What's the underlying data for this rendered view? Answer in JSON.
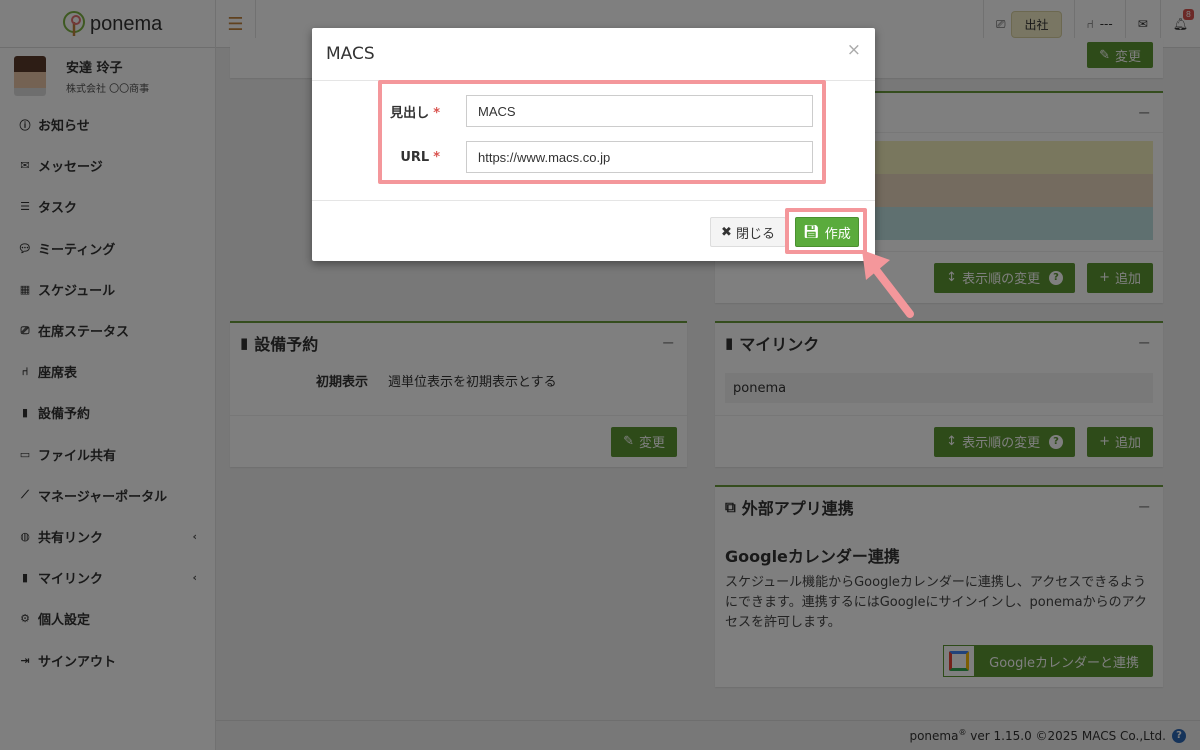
{
  "app": {
    "brand": "ponema"
  },
  "topbar": {
    "attendance_status": "出社",
    "seat_status": "---",
    "notification_count": "8"
  },
  "user": {
    "name": "安達 玲子",
    "company": "株式会社 〇〇商事"
  },
  "sidebar": {
    "items": [
      {
        "label": "お知らせ",
        "icon": "info-icon"
      },
      {
        "label": "メッセージ",
        "icon": "envelope-icon"
      },
      {
        "label": "タスク",
        "icon": "list-check-icon"
      },
      {
        "label": "ミーティング",
        "icon": "chat-icon"
      },
      {
        "label": "スケジュール",
        "icon": "calendar-icon"
      },
      {
        "label": "在席ステータス",
        "icon": "presence-icon"
      },
      {
        "label": "座席表",
        "icon": "chair-icon"
      },
      {
        "label": "設備予約",
        "icon": "door-icon"
      },
      {
        "label": "ファイル共有",
        "icon": "folder-icon"
      },
      {
        "label": "マネージャーポータル",
        "icon": "chart-icon"
      },
      {
        "label": "共有リンク",
        "icon": "globe-icon"
      },
      {
        "label": "マイリンク",
        "icon": "bookmark-icon"
      },
      {
        "label": "個人設定",
        "icon": "gear-icon"
      },
      {
        "label": "サインアウト",
        "icon": "signout-icon"
      }
    ]
  },
  "panels": {
    "top_left_btn": "変更",
    "facility": {
      "title": "設備予約",
      "setting_label": "初期表示",
      "setting_value": "週単位表示を初期表示とする",
      "change_label": "変更"
    },
    "colors": {
      "order_label": "表示順の変更",
      "add_label": "追加",
      "row_colors": [
        "#f3efbd",
        "#e9d6bf",
        "#bfe1e1"
      ]
    },
    "mylink": {
      "title": "マイリンク",
      "items": [
        "ponema"
      ],
      "order_label": "表示順の変更",
      "add_label": "追加"
    },
    "external": {
      "title": "外部アプリ連携",
      "gcal_title": "Googleカレンダー連携",
      "gcal_desc": "スケジュール機能からGoogleカレンダーに連携し、アクセスできるようにできます。連携するにはGoogleにサインインし、ponemaからのアクセスを許可します。",
      "gcal_button": "Googleカレンダーと連携"
    }
  },
  "footer": {
    "brand": "ponema",
    "reg": "®",
    "version": "ver 1.15.0 ©2025 MACS Co.,Ltd."
  },
  "modal": {
    "title": "MACS",
    "heading_label": "見出し",
    "heading_value": "MACS",
    "url_label": "URL",
    "url_value": "https://www.macs.co.jp",
    "required_mark": "*",
    "close_label": "閉じる",
    "create_label": "作成"
  },
  "colors": {
    "accent_green": "#5c9632",
    "panel_border": "#6a9a3c",
    "highlight": "#f4979b"
  }
}
